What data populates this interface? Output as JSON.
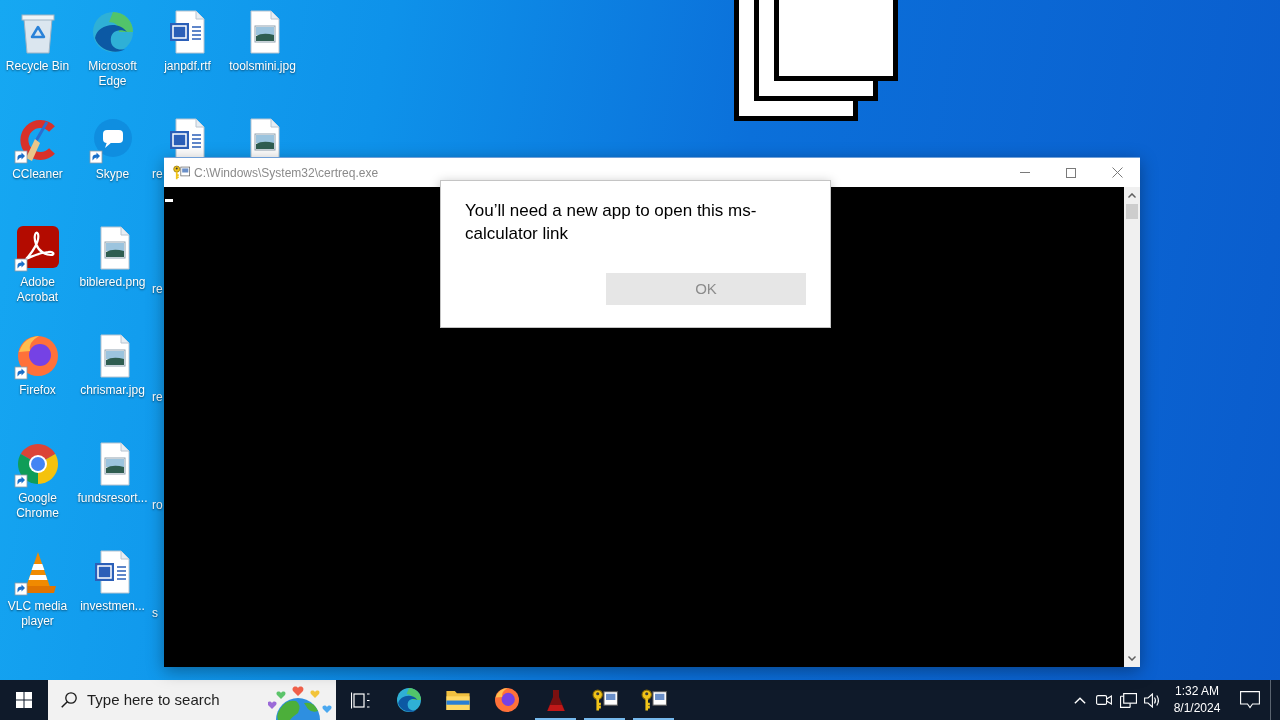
{
  "desktop_icons": [
    [
      {
        "label": "Recycle Bin"
      },
      {
        "label": "CCleaner"
      },
      {
        "label": "Adobe Acrobat"
      },
      {
        "label": "Firefox"
      },
      {
        "label": "Google Chrome"
      },
      {
        "label": "VLC media player"
      }
    ],
    [
      {
        "label": "Microsoft Edge"
      },
      {
        "label": "Skype"
      },
      {
        "label": "biblered.png"
      },
      {
        "label": "chrismar.jpg"
      },
      {
        "label": "fundsresort..."
      },
      {
        "label": "investmen..."
      }
    ],
    [
      {
        "label": "janpdf.rtf"
      },
      {
        "label": "re"
      },
      {
        "label": "re"
      },
      {
        "label": "re"
      },
      {
        "label": "ro"
      },
      {
        "label": "s"
      }
    ],
    [
      {
        "label": "toolsmini.jpg"
      }
    ]
  ],
  "console_window": {
    "title": "C:\\Windows\\System32\\certreq.exe"
  },
  "dialog": {
    "message": "You’ll need a new app to open this ms-calculator link",
    "button": {
      "label": "OK",
      "disabled": true
    }
  },
  "taskbar": {
    "search": {
      "placeholder": "Type here to search"
    },
    "apps": [
      {
        "running": false
      },
      {
        "running": false
      },
      {
        "running": false
      },
      {
        "running": true
      },
      {
        "running": true
      },
      {
        "running": true
      }
    ],
    "clock": {
      "time": "1:32 AM",
      "date": "8/1/2024"
    }
  }
}
